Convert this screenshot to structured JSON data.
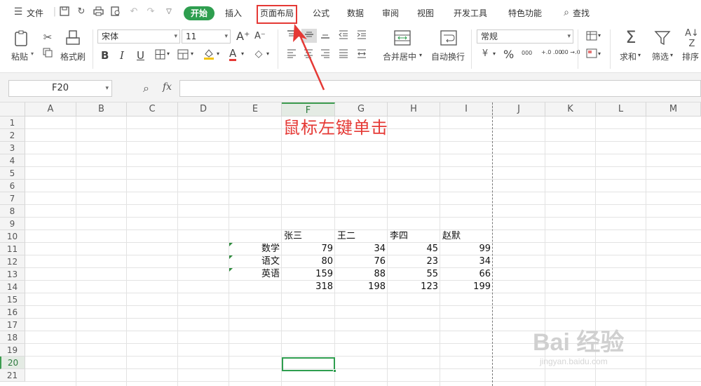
{
  "menubar": {
    "menu_label": "文件",
    "tabs": [
      "开始",
      "插入",
      "页面布局",
      "公式",
      "数据",
      "审阅",
      "视图",
      "开发工具",
      "特色功能",
      "查找"
    ]
  },
  "ribbon": {
    "paste": "粘贴",
    "format_painter": "格式刷",
    "font_name": "宋体",
    "font_size": "11",
    "number_format": "常规",
    "merge_center": "合并居中",
    "wrap_text": "自动换行",
    "sum": "求和",
    "filter": "筛选",
    "sort": "排序",
    "grow_font": "A⁺",
    "shrink_font": "A⁻",
    "bold": "B",
    "italic": "I",
    "underline": "U",
    "font_color_letter": "A",
    "percent": "%",
    "thousands": "000",
    "inc_decimal": "+.0 .00",
    "dec_decimal": ".00 →.0"
  },
  "formula_bar": {
    "name_box": "F20",
    "fx": "fx",
    "formula": ""
  },
  "grid": {
    "columns": [
      "A",
      "B",
      "C",
      "D",
      "E",
      "F",
      "G",
      "H",
      "I",
      "J",
      "K",
      "L",
      "M"
    ],
    "rows": [
      "1",
      "2",
      "3",
      "4",
      "5",
      "6",
      "7",
      "8",
      "9",
      "10",
      "11",
      "12",
      "13",
      "14",
      "15",
      "16",
      "17",
      "18",
      "19",
      "20",
      "21"
    ],
    "selected_cell": "F20",
    "header_row": [
      "张三",
      "王二",
      "李四",
      "赵默"
    ],
    "data_rows": [
      {
        "label": "数学",
        "values": [
          "79",
          "34",
          "45",
          "99"
        ]
      },
      {
        "label": "语文",
        "values": [
          "80",
          "76",
          "23",
          "34"
        ]
      },
      {
        "label": "英语",
        "values": [
          "159",
          "88",
          "55",
          "66"
        ]
      },
      {
        "label": "",
        "values": [
          "318",
          "198",
          "123",
          "199"
        ]
      }
    ]
  },
  "annotation": {
    "text": "鼠标左键单击",
    "color": "#e53935"
  },
  "watermark": {
    "text": "Bai 经验",
    "sub": "jingyan.baidu.com"
  },
  "colors": {
    "accent_green": "#2e9e4f",
    "highlight_red": "#e53935"
  }
}
